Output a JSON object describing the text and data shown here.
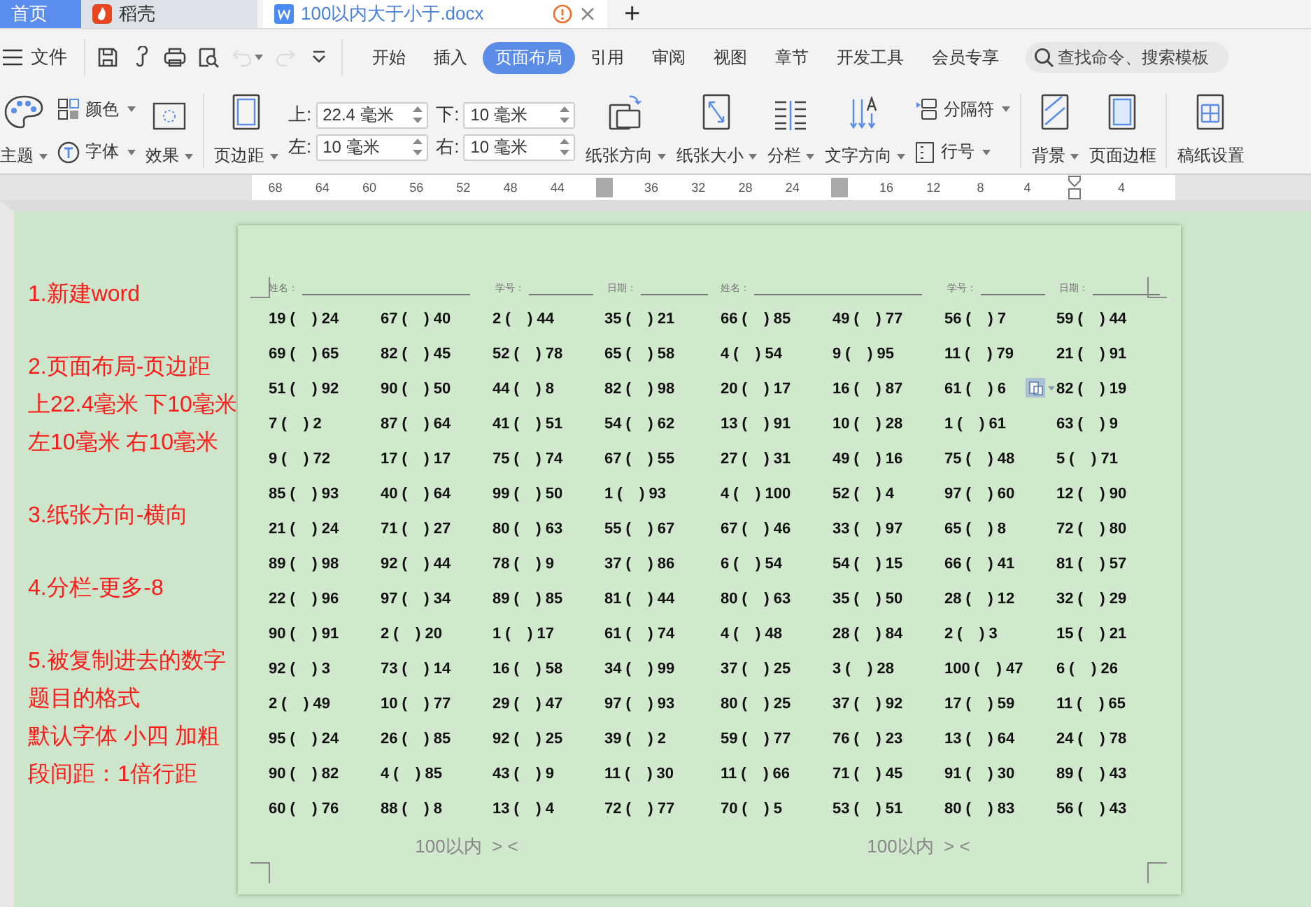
{
  "tab_bar": {
    "tabs": [
      {
        "kind": "home",
        "label": "首页",
        "selected": false
      },
      {
        "kind": "app",
        "label": "稻壳",
        "selected": false
      },
      {
        "kind": "document",
        "label": "100以内大于小于.docx",
        "selected": true
      }
    ],
    "new_tab": "+"
  },
  "menu_bar": {
    "file": "文件",
    "quick_access": [
      {
        "disabled": false
      },
      {
        "disabled": false
      },
      {
        "disabled": false
      },
      {
        "disabled": false
      },
      {
        "disabled": true
      },
      {
        "disabled": true
      },
      {
        "disabled": false
      }
    ],
    "tabs": [
      {
        "label": "开始",
        "selected": false
      },
      {
        "label": "插入",
        "selected": false
      },
      {
        "label": "页面布局",
        "selected": true
      },
      {
        "label": "引用",
        "selected": false
      },
      {
        "label": "审阅",
        "selected": false
      },
      {
        "label": "视图",
        "selected": false
      },
      {
        "label": "章节",
        "selected": false
      },
      {
        "label": "开发工具",
        "selected": false
      },
      {
        "label": "会员专享",
        "selected": false
      }
    ],
    "search": {
      "placeholder": "查找命令、搜索模板"
    }
  },
  "ribbon": {
    "items": [
      {
        "kind": "large",
        "label": "主题",
        "dropdown": true
      },
      {
        "kind": "stack",
        "items": [
          {
            "label": "颜色",
            "dropdown": true
          },
          {
            "label": "字体",
            "dropdown": true
          }
        ]
      },
      {
        "kind": "large",
        "label": "效果",
        "dropdown": true
      },
      {
        "kind": "separator"
      },
      {
        "kind": "large",
        "label": "页边距",
        "dropdown": true
      },
      {
        "kind": "margins",
        "fields": [
          {
            "label": "上:",
            "value": "22.4 毫米"
          },
          {
            "label": "下:",
            "value": "10 毫米"
          },
          {
            "label": "左:",
            "value": "10 毫米"
          },
          {
            "label": "右:",
            "value": "10 毫米"
          }
        ]
      },
      {
        "kind": "large",
        "label": "纸张方向",
        "dropdown": true
      },
      {
        "kind": "large",
        "label": "纸张大小",
        "dropdown": true
      },
      {
        "kind": "large",
        "label": "分栏",
        "dropdown": true
      },
      {
        "kind": "large",
        "label": "文字方向",
        "dropdown": true
      },
      {
        "kind": "stack",
        "items": [
          {
            "label": "分隔符",
            "dropdown": true
          },
          {
            "label": "行号",
            "dropdown": true
          }
        ]
      },
      {
        "kind": "separator"
      },
      {
        "kind": "large",
        "label": "背景",
        "dropdown": true
      },
      {
        "kind": "large",
        "label": "页面边框",
        "dropdown": false
      },
      {
        "kind": "separator"
      },
      {
        "kind": "large",
        "label": "稿纸设置",
        "dropdown": false
      }
    ]
  },
  "ruler": {
    "items": [
      {
        "kind": "number",
        "text": "68"
      },
      {
        "kind": "number",
        "text": "64"
      },
      {
        "kind": "number",
        "text": "60"
      },
      {
        "kind": "number",
        "text": "56"
      },
      {
        "kind": "number",
        "text": "52"
      },
      {
        "kind": "number",
        "text": "48"
      },
      {
        "kind": "number",
        "text": "44"
      },
      {
        "kind": "marker"
      },
      {
        "kind": "number",
        "text": "36"
      },
      {
        "kind": "number",
        "text": "32"
      },
      {
        "kind": "number",
        "text": "28"
      },
      {
        "kind": "number",
        "text": "24"
      },
      {
        "kind": "marker"
      },
      {
        "kind": "number",
        "text": "16"
      },
      {
        "kind": "number",
        "text": "12"
      },
      {
        "kind": "number",
        "text": "8"
      },
      {
        "kind": "number",
        "text": "4"
      },
      {
        "kind": "indent"
      },
      {
        "kind": "number",
        "text": "4"
      }
    ]
  },
  "notes": [
    [
      "1.新建word"
    ],
    [
      "2.页面布局-页边距",
      "上22.4毫米 下10毫米",
      "左10毫米 右10毫米"
    ],
    [
      "3.纸张方向-横向"
    ],
    [
      "4.分栏-更多-8"
    ],
    [
      "5.被复制进去的数字题目的格式",
      "默认字体 小四 加粗",
      "段间距：1倍行距"
    ]
  ],
  "page": {
    "sections": [
      {
        "header": [
          "姓名：",
          "学号：",
          "日期："
        ],
        "rows": [
          [
            "19 (    ) 24",
            "67 (    ) 40",
            "2 (    ) 44",
            "35 (    ) 21"
          ],
          [
            "69 (    ) 65",
            "82 (    ) 45",
            "52 (    ) 78",
            "65 (    ) 58"
          ],
          [
            "51 (    ) 92",
            "90 (    ) 50",
            "44 (    ) 8",
            "82 (    ) 98"
          ],
          [
            "7 (    ) 2",
            "87 (    ) 64",
            "41 (    ) 51",
            "54 (    ) 62"
          ],
          [
            "9 (    ) 72",
            "17 (    ) 17",
            "75 (    ) 74",
            "67 (    ) 55"
          ],
          [
            "85 (    ) 93",
            "40 (    ) 64",
            "99 (    ) 50",
            "1 (    ) 93"
          ],
          [
            "21 (    ) 24",
            "71 (    ) 27",
            "80 (    ) 63",
            "55 (    ) 67"
          ],
          [
            "89 (    ) 98",
            "92 (    ) 44",
            "78 (    ) 9",
            "37 (    ) 86"
          ],
          [
            "22 (    ) 96",
            "97 (    ) 34",
            "89 (    ) 85",
            "81 (    ) 44"
          ],
          [
            "90 (    ) 91",
            "2 (    ) 20",
            "1 (    ) 17",
            "61 (    ) 74"
          ],
          [
            "92 (    ) 3",
            "73 (    ) 14",
            "16 (    ) 58",
            "34 (    ) 99"
          ],
          [
            "2 (    ) 49",
            "10 (    ) 77",
            "29 (    ) 47",
            "97 (    ) 93"
          ],
          [
            "95 (    ) 24",
            "26 (    ) 85",
            "92 (    ) 25",
            "39 (    ) 2"
          ],
          [
            "90 (    ) 82",
            "4 (    ) 85",
            "43 (    ) 9",
            "11 (    ) 30"
          ],
          [
            "60 (    ) 76",
            "88 (    ) 8",
            "13 (    ) 4",
            "72 (    ) 77"
          ]
        ],
        "footer": "100以内  > <"
      },
      {
        "header": [
          "姓名：",
          "学号：",
          "日期："
        ],
        "rows": [
          [
            "66 (    ) 85",
            "49 (    ) 77",
            "56 (    ) 7",
            "59 (    ) 44"
          ],
          [
            "4 (    ) 54",
            "9 (    ) 95",
            "11 (    ) 79",
            "21 (    ) 91"
          ],
          [
            "20 (    ) 17",
            "16 (    ) 87",
            "61 (    ) 6",
            "82 (    ) 19"
          ],
          [
            "13 (    ) 91",
            "10 (    ) 28",
            "1 (    ) 61",
            "63 (    ) 9"
          ],
          [
            "27 (    ) 31",
            "49 (    ) 16",
            "75 (    ) 48",
            "5 (    ) 71"
          ],
          [
            "4 (    ) 100",
            "52 (    ) 4",
            "97 (    ) 60",
            "12 (    ) 90"
          ],
          [
            "67 (    ) 46",
            "33 (    ) 97",
            "65 (    ) 8",
            "72 (    ) 80"
          ],
          [
            "6 (    ) 54",
            "54 (    ) 15",
            "66 (    ) 41",
            "81 (    ) 57"
          ],
          [
            "80 (    ) 63",
            "35 (    ) 50",
            "28 (    ) 12",
            "32 (    ) 29"
          ],
          [
            "4 (    ) 48",
            "28 (    ) 84",
            "2 (    ) 3",
            "15 (    ) 21"
          ],
          [
            "37 (    ) 25",
            "3 (    ) 28",
            "100 (    ) 47",
            "6 (    ) 26"
          ],
          [
            "80 (    ) 25",
            "37 (    ) 92",
            "17 (    ) 59",
            "11 (    ) 65"
          ],
          [
            "59 (    ) 77",
            "76 (    ) 23",
            "13 (    ) 64",
            "24 (    ) 78"
          ],
          [
            "11 (    ) 66",
            "71 (    ) 45",
            "91 (    ) 30",
            "89 (    ) 43"
          ],
          [
            "70 (    ) 5",
            "53 (    ) 51",
            "80 (    ) 83",
            "56 (    ) 43"
          ]
        ],
        "footer": "100以内  > <"
      }
    ]
  }
}
